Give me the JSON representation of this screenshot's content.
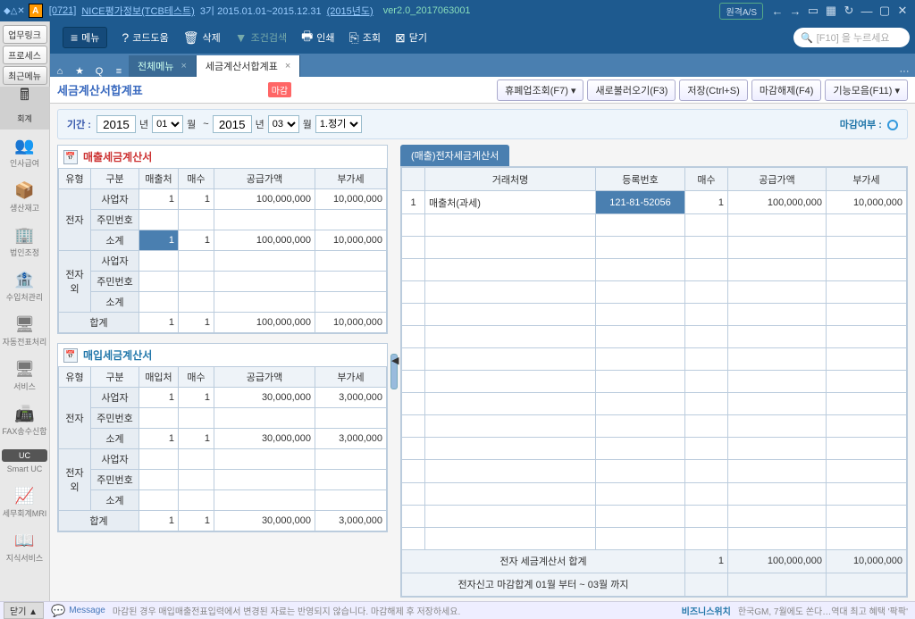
{
  "titlebar": {
    "app_initial": "A",
    "bracket": "[0721]",
    "company": "NICE평가정보(TCB테스트)",
    "term": "3기 2015.01.01~2015.12.31",
    "year": "(2015년도)",
    "version": "ver2.0_2017063001",
    "remote": "원격A/S"
  },
  "pins": {
    "p1": "업무링크",
    "p2": "프로세스",
    "p3": "최근메뉴"
  },
  "toolbar": {
    "menu": "메뉴",
    "code": "코드도움",
    "delete": "삭제",
    "filter": "조건검색",
    "print": "인쇄",
    "search": "조회",
    "close": "닫기",
    "search_placeholder": "[F10] 을 누르세요"
  },
  "tabs": {
    "t1": "전체메뉴",
    "t2": "세금계산서합계표"
  },
  "nav": {
    "n0": "회계",
    "n1": "인사급여",
    "n2": "생산재고",
    "n3": "법인조정",
    "n4": "수입처관리",
    "n5": "자동전표처리",
    "n6": "서비스",
    "n7": "FAX송수신함",
    "n8": "Smart UC",
    "n9": "세무회계MRI",
    "n10": "지식서비스"
  },
  "page": {
    "title": "세금계산서합계표",
    "badge": "마감",
    "buttons": {
      "b1": "휴폐업조회(F7)",
      "b2": "새로불러오기(F3)",
      "b3": "저장(Ctrl+S)",
      "b4": "마감해제(F4)",
      "b5": "기능모음(F11)"
    }
  },
  "filter": {
    "label": "기간 :",
    "y1": "2015",
    "m1": "01",
    "y2": "2015",
    "m2": "03",
    "year_u": "년",
    "month_u": "월",
    "sep": "~",
    "jung": "1.정기",
    "magam": "마감여부 :"
  },
  "panel1": {
    "title": "매출세금계산서",
    "h": {
      "c1": "유형",
      "c2": "구분",
      "c3": "매출처",
      "c4": "매수",
      "c5": "공급가액",
      "c6": "부가세"
    },
    "rows": {
      "g1": "전자",
      "r1": {
        "gubun": "사업자",
        "cnt": "1",
        "qty": "1",
        "amt": "100,000,000",
        "vat": "10,000,000"
      },
      "r2": {
        "gubun": "주민번호"
      },
      "r3": {
        "gubun": "소계",
        "cnt": "1",
        "qty": "1",
        "amt": "100,000,000",
        "vat": "10,000,000"
      },
      "g2": "전자외",
      "r4": {
        "gubun": "사업자"
      },
      "r5": {
        "gubun": "주민번호"
      },
      "r6": {
        "gubun": "소계"
      },
      "r7": {
        "gubun": "합계",
        "cnt": "1",
        "qty": "1",
        "amt": "100,000,000",
        "vat": "10,000,000"
      }
    }
  },
  "panel2": {
    "title": "매입세금계산서",
    "h": {
      "c1": "유형",
      "c2": "구분",
      "c3": "매입처",
      "c4": "매수",
      "c5": "공급가액",
      "c6": "부가세"
    },
    "rows": {
      "g1": "전자",
      "r1": {
        "gubun": "사업자",
        "cnt": "1",
        "qty": "1",
        "amt": "30,000,000",
        "vat": "3,000,000"
      },
      "r2": {
        "gubun": "주민번호"
      },
      "r3": {
        "gubun": "소계",
        "cnt": "1",
        "qty": "1",
        "amt": "30,000,000",
        "vat": "3,000,000"
      },
      "g2": "전자외",
      "r4": {
        "gubun": "사업자"
      },
      "r5": {
        "gubun": "주민번호"
      },
      "r6": {
        "gubun": "소계"
      },
      "r7": {
        "gubun": "합계",
        "cnt": "1",
        "qty": "1",
        "amt": "30,000,000",
        "vat": "3,000,000"
      }
    }
  },
  "detail": {
    "title": "(매출)전자세금계산서",
    "h": {
      "c1": "거래처명",
      "c2": "등록번호",
      "c3": "매수",
      "c4": "공급가액",
      "c5": "부가세"
    },
    "row": {
      "no": "1",
      "name": "매출처(과세)",
      "reg": "121-81-52056",
      "qty": "1",
      "amt": "100,000,000",
      "vat": "10,000,000"
    },
    "foot1": {
      "label": "전자 세금계산서 합계",
      "qty": "1",
      "amt": "100,000,000",
      "vat": "10,000,000"
    },
    "foot2": "전자신고 마감합계 01월 부터 ~ 03월 까지"
  },
  "status": {
    "close": "닫기",
    "msg": "Message",
    "text": "마감된 경우 매입매출전표입력에서 변경된 자료는 반영되지 않습니다. 마감해제 후 저장하세요.",
    "biz": "비즈니스위치",
    "news": "한국GM, 7월에도 쏜다…역대 최고 혜택 '팍팍'"
  }
}
